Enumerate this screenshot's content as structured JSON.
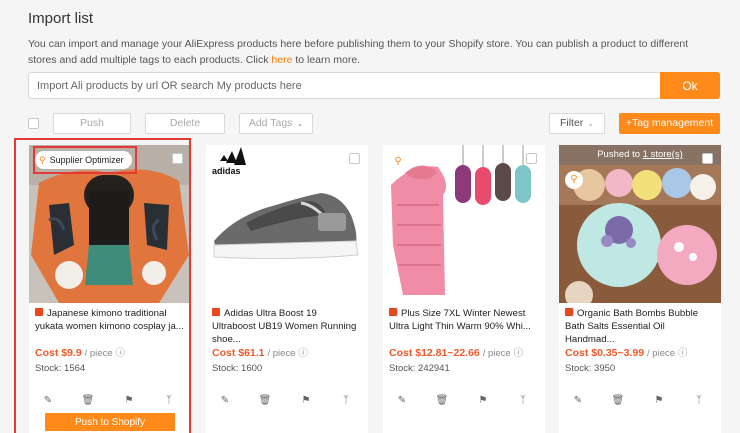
{
  "page": {
    "title": "Import list",
    "desc_before_link": "You can import and manage your AliExpress products here before publishing them to your Shopify store. You can publish a product to different stores and add multiple tags to each products. Click ",
    "desc_link": "here",
    "desc_after_link": " to learn more."
  },
  "search": {
    "placeholder": "Import Ali products by url OR search My products here",
    "ok_label": "Ok"
  },
  "toolbar": {
    "push_label": "Push",
    "delete_label": "Delete",
    "add_tags_label": "Add Tags",
    "filter_label": "Filter",
    "tag_management_label": "+Tag management"
  },
  "products": [
    {
      "title": "Japanese kimono traditional yukata women kimono cosplay ja...",
      "price": "Cost $9.9",
      "per": "/ piece",
      "stock": "Stock: 1564",
      "badge": "Supplier Optimizer",
      "push_label": "Push to Shopify"
    },
    {
      "title": "Adidas Ultra Boost 19 Ultraboost UB19 Women Running shoe...",
      "price": "Cost $61.1",
      "per": "/ piece",
      "stock": "Stock: 1600",
      "logo_text": "adidas"
    },
    {
      "title": "Plus Size 7XL Winter Newest Ultra Light Thin Warm 90% Whi...",
      "price": "Cost $12.81~22.66",
      "per": "/ piece",
      "stock": "Stock: 242941"
    },
    {
      "title": "Organic Bath Bombs Bubble Bath Salts Essential Oil Handmad...",
      "price": "Cost $0.35~3.99",
      "per": "/ piece",
      "stock": "Stock: 3950",
      "pushed_prefix": "Pushed to ",
      "pushed_link": "1 store(s)"
    }
  ],
  "colors": {
    "accent": "#ff8a1a",
    "price": "#f05a28",
    "highlight_box": "#e53935"
  }
}
